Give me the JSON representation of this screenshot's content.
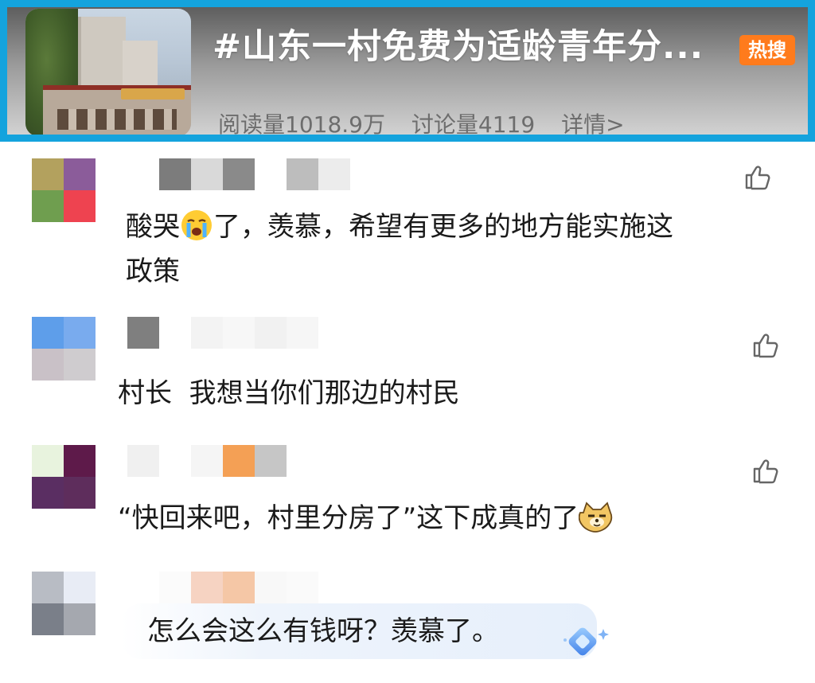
{
  "topic": {
    "title": "#山东一村免费为适龄青年分...",
    "badge": "热搜",
    "reads": "阅读量1018.9万",
    "discussions": "讨论量4119",
    "details": "详情>"
  },
  "icons": {
    "like": "thumbs-up-icon",
    "crying": "crying-face-icon",
    "doge": "doge-face-icon",
    "ai": "sparkle-diamond-icon"
  },
  "colors": {
    "accent_border": "#14a3dd",
    "hot_badge": "#ff7b1c"
  },
  "comments": [
    {
      "text_line1": "酸哭",
      "text_line1_after": "了，羡慕，希望有更多的地方能实施这",
      "text_line2": "政策"
    },
    {
      "text": "村长  我想当你们那边的村民"
    },
    {
      "text_before": "“快回来吧，村里分房了”这下成真的了"
    },
    {
      "text": "怎么会这么有钱呀？羡慕了。"
    }
  ]
}
